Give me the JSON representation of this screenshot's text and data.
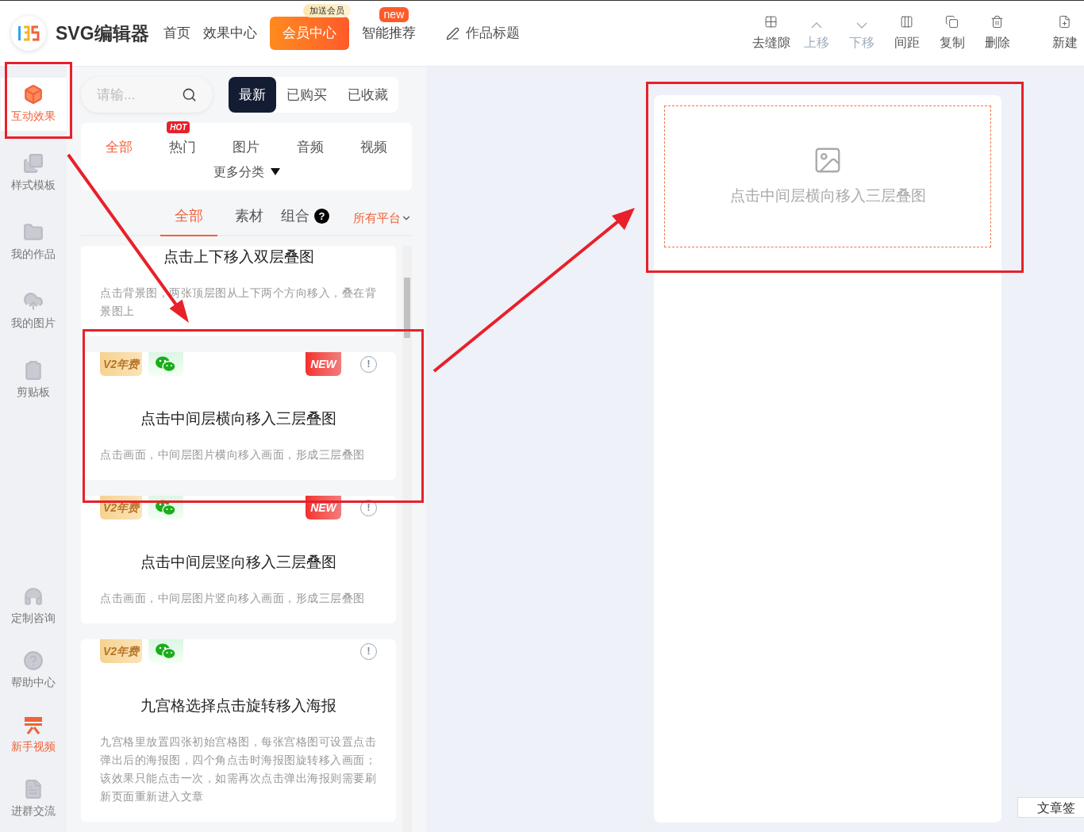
{
  "header": {
    "logo": "SVG编辑器",
    "nav": [
      {
        "label": "首页",
        "kind": "link"
      },
      {
        "label": "效果中心",
        "kind": "link"
      },
      {
        "label": "会员中心",
        "kind": "primary",
        "badge": "加送会员"
      },
      {
        "label": "智能推荐",
        "kind": "link",
        "badge": "new"
      }
    ],
    "title_field": {
      "placeholder": "作品标题"
    },
    "tools": [
      {
        "label": "去缝隙",
        "kind": "gap",
        "disabled": false
      },
      {
        "label": "上移",
        "kind": "up",
        "disabled": true
      },
      {
        "label": "下移",
        "kind": "down",
        "disabled": true
      },
      {
        "label": "间距",
        "kind": "spacing",
        "disabled": false
      },
      {
        "label": "复制",
        "kind": "copy",
        "disabled": false
      },
      {
        "label": "删除",
        "kind": "delete",
        "disabled": false
      },
      {
        "label": "新建",
        "kind": "new",
        "disabled": false
      }
    ]
  },
  "sidebar": {
    "items": [
      {
        "label": "互动效果",
        "kind": "cube",
        "selected": true,
        "highlighted": false
      },
      {
        "label": "样式模板",
        "kind": "template",
        "selected": false,
        "highlighted": false
      },
      {
        "label": "我的作品",
        "kind": "folder",
        "selected": false,
        "highlighted": false
      },
      {
        "label": "我的图片",
        "kind": "cloud",
        "selected": false,
        "highlighted": false
      },
      {
        "label": "剪贴板",
        "kind": "clipboard",
        "selected": false,
        "highlighted": false
      }
    ],
    "bottom_items": [
      {
        "label": "定制咨询",
        "kind": "headset",
        "selected": false,
        "highlighted": false
      },
      {
        "label": "帮助中心",
        "kind": "help",
        "selected": false,
        "highlighted": false
      },
      {
        "label": "新手视频",
        "kind": "video",
        "selected": false,
        "highlighted": true
      },
      {
        "label": "进群交流",
        "kind": "doc",
        "selected": false,
        "highlighted": false
      }
    ]
  },
  "panel": {
    "search": {
      "placeholder": "请输..."
    },
    "sort_tabs": [
      {
        "label": "最新",
        "selected": true
      },
      {
        "label": "已购买",
        "selected": false
      },
      {
        "label": "已收藏",
        "selected": false
      }
    ],
    "categories": [
      {
        "label": "全部",
        "selected": true
      },
      {
        "label": "热门",
        "selected": false,
        "badge": "HOT"
      },
      {
        "label": "图片",
        "selected": false
      },
      {
        "label": "音频",
        "selected": false
      },
      {
        "label": "视频",
        "selected": false
      }
    ],
    "more": "更多分类",
    "type_tabs": [
      {
        "label": "全部",
        "selected": true,
        "help": false
      },
      {
        "label": "素材",
        "selected": false,
        "help": false
      },
      {
        "label": "组合",
        "selected": false,
        "help": true
      }
    ],
    "help_mark": "?",
    "platform": "所有平台",
    "cards": [
      {
        "title": "点击上下移入双层叠图",
        "description": "点击背景图，两张顶层图从上下两个方向移入，叠在背景图上"
      },
      {
        "title": "点击中间层横向移入三层叠图",
        "description": "点击画面，中间层图片横向移入画面，形成三层叠图",
        "vip": "V2年费",
        "wechat": true,
        "new_label": "NEW",
        "info": "!"
      },
      {
        "title": "点击中间层竖向移入三层叠图",
        "description": "点击画面，中间层图片竖向移入画面，形成三层叠图",
        "vip": "V2年费",
        "wechat": true,
        "new_label": "NEW",
        "info": "!"
      },
      {
        "title": "九宫格选择点击旋转移入海报",
        "description": "九宫格里放置四张初始宫格图，每张宫格图可设置点击弹出后的海报图，四个角点击时海报图旋转移入画面；该效果只能点击一次，如需再次点击弹出海报则需要刷新页面重新进入文章",
        "vip": "V2年费",
        "wechat": true,
        "info": "!"
      }
    ]
  },
  "canvas": {
    "placeholder_text": "点击中间层横向移入三层叠图"
  },
  "corner_tab": "文章签"
}
